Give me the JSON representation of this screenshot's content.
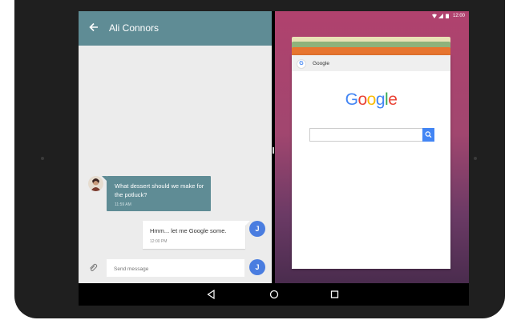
{
  "chat": {
    "contact_name": "Ali Connors",
    "incoming_message": "What dessert should we make for the potluck?",
    "incoming_time": "11:59 AM",
    "outgoing_message": "Hmm... let me Google some.",
    "outgoing_time": "12:00 PM",
    "avatar_letter": "J",
    "compose_placeholder": "Send message"
  },
  "statusbar": {
    "time": "12:00"
  },
  "recents": {
    "card_title": "Google",
    "card_icon_letter": "G",
    "logo_text": "Google"
  },
  "colors": {
    "appbar": "#5f8c95",
    "accent_blue": "#4a7de0",
    "google_blue": "#4285f4"
  }
}
